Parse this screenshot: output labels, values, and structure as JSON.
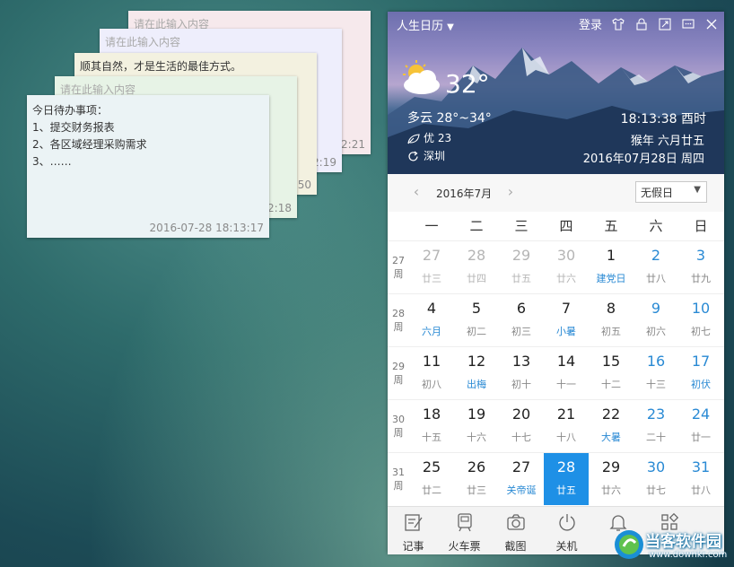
{
  "notes": [
    {
      "placeholder": "请在此输入内容",
      "time": "2:21"
    },
    {
      "placeholder": "请在此输入内容",
      "time": "2:19"
    },
    {
      "text": "顺其自然，才是生活的最佳方式。",
      "time": ":50"
    },
    {
      "placeholder": "请在此输入内容",
      "time": "2:18"
    },
    {
      "lines": [
        "今日待办事项：",
        "1、提交财务报表",
        "2、各区域经理采购需求",
        "3、……"
      ],
      "time": "2016-07-28 18:13:17"
    }
  ],
  "calendar": {
    "app_title": "人生日历",
    "login": "登录",
    "weather": {
      "temp": "32°",
      "desc": "多云 28°~34°",
      "aqi": "优 23",
      "city": "深圳"
    },
    "clock": "18:13:38 酉时",
    "lunar": "猴年 六月廿五",
    "gregorian": "2016年07月28日 周四",
    "month_label": "2016年7月",
    "holiday_select": "无假日",
    "weekdays": [
      "一",
      "二",
      "三",
      "四",
      "五",
      "六",
      "日"
    ],
    "week_nums": [
      {
        "num": "27",
        "unit": "周"
      },
      {
        "num": "28",
        "unit": "周"
      },
      {
        "num": "29",
        "unit": "周"
      },
      {
        "num": "30",
        "unit": "周"
      },
      {
        "num": "31",
        "unit": "周"
      }
    ],
    "weeks": [
      [
        {
          "d": "27",
          "l": "廿三",
          "other": true
        },
        {
          "d": "28",
          "l": "廿四",
          "other": true
        },
        {
          "d": "29",
          "l": "廿五",
          "other": true
        },
        {
          "d": "30",
          "l": "廿六",
          "other": true
        },
        {
          "d": "1",
          "l": "建党日",
          "accent": true
        },
        {
          "d": "2",
          "l": "廿八",
          "weekend": true
        },
        {
          "d": "3",
          "l": "廿九",
          "weekend": true
        }
      ],
      [
        {
          "d": "4",
          "l": "六月",
          "accent": true
        },
        {
          "d": "5",
          "l": "初二"
        },
        {
          "d": "6",
          "l": "初三"
        },
        {
          "d": "7",
          "l": "小暑",
          "accent": true
        },
        {
          "d": "8",
          "l": "初五"
        },
        {
          "d": "9",
          "l": "初六",
          "weekend": true
        },
        {
          "d": "10",
          "l": "初七",
          "weekend": true
        }
      ],
      [
        {
          "d": "11",
          "l": "初八"
        },
        {
          "d": "12",
          "l": "出梅",
          "accent": true
        },
        {
          "d": "13",
          "l": "初十"
        },
        {
          "d": "14",
          "l": "十一"
        },
        {
          "d": "15",
          "l": "十二"
        },
        {
          "d": "16",
          "l": "十三",
          "weekend": true
        },
        {
          "d": "17",
          "l": "初伏",
          "weekend": true,
          "accent": true
        }
      ],
      [
        {
          "d": "18",
          "l": "十五"
        },
        {
          "d": "19",
          "l": "十六"
        },
        {
          "d": "20",
          "l": "十七"
        },
        {
          "d": "21",
          "l": "十八"
        },
        {
          "d": "22",
          "l": "大暑",
          "accent": true
        },
        {
          "d": "23",
          "l": "二十",
          "weekend": true
        },
        {
          "d": "24",
          "l": "廿一",
          "weekend": true
        }
      ],
      [
        {
          "d": "25",
          "l": "廿二"
        },
        {
          "d": "26",
          "l": "廿三"
        },
        {
          "d": "27",
          "l": "关帝诞",
          "accent": true
        },
        {
          "d": "28",
          "l": "廿五",
          "today": true
        },
        {
          "d": "29",
          "l": "廿六"
        },
        {
          "d": "30",
          "l": "廿七",
          "weekend": true
        },
        {
          "d": "31",
          "l": "廿八",
          "weekend": true
        }
      ]
    ],
    "tools": [
      {
        "label": "记事",
        "icon": "note-edit-icon"
      },
      {
        "label": "火车票",
        "icon": "train-icon"
      },
      {
        "label": "截图",
        "icon": "camera-icon"
      },
      {
        "label": "关机",
        "icon": "power-icon"
      },
      {
        "label": "",
        "icon": "bell-icon"
      },
      {
        "label": "",
        "icon": "apps-grid-icon"
      }
    ]
  },
  "watermark": {
    "text": "当客软件园",
    "url": "www.downkr.com"
  }
}
